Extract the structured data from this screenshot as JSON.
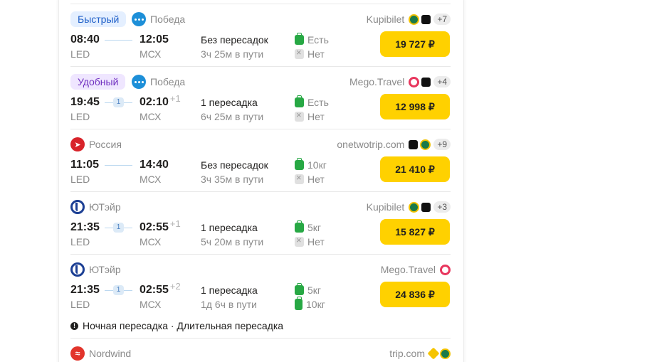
{
  "flights": [
    {
      "badge": "Быстрый",
      "badge_style": "fast",
      "logo": "pobeda",
      "airline": "Победа",
      "seller": "Kupibilet",
      "seller_icons": [
        "green",
        "black"
      ],
      "more": "+7",
      "dep_time": "08:40",
      "dep_airport": "LED",
      "arr_time": "12:05",
      "arr_plus": "",
      "arr_airport": "МСХ",
      "stops": "Без пересадок",
      "stop_count": "",
      "duration": "3ч 25м в пути",
      "baggage": [
        {
          "icon": "ok",
          "text": "Есть"
        },
        {
          "icon": "no",
          "text": "Нет"
        }
      ],
      "price": "19 727 ₽",
      "note": ""
    },
    {
      "badge": "Удобный",
      "badge_style": "comfy",
      "logo": "pobeda",
      "airline": "Победа",
      "seller": "Mego.Travel",
      "seller_icons": [
        "pink",
        "black"
      ],
      "more": "+4",
      "dep_time": "19:45",
      "dep_airport": "LED",
      "arr_time": "02:10",
      "arr_plus": "+1",
      "arr_airport": "МСХ",
      "stops": "1 пересадка",
      "stop_count": "1",
      "duration": "6ч 25м в пути",
      "baggage": [
        {
          "icon": "ok",
          "text": "Есть"
        },
        {
          "icon": "no",
          "text": "Нет"
        }
      ],
      "price": "12 998 ₽",
      "note": ""
    },
    {
      "badge": "",
      "badge_style": "",
      "logo": "rossiya",
      "airline": "Россия",
      "seller": "onetwotrip.com",
      "seller_icons": [
        "black",
        "green"
      ],
      "more": "+9",
      "dep_time": "11:05",
      "dep_airport": "LED",
      "arr_time": "14:40",
      "arr_plus": "",
      "arr_airport": "МСХ",
      "stops": "Без пересадок",
      "stop_count": "",
      "duration": "3ч 35м в пути",
      "baggage": [
        {
          "icon": "ok",
          "text": "10кг"
        },
        {
          "icon": "no",
          "text": "Нет"
        }
      ],
      "price": "21 410 ₽",
      "note": ""
    },
    {
      "badge": "",
      "badge_style": "",
      "logo": "utair",
      "airline": "ЮТэйр",
      "seller": "Kupibilet",
      "seller_icons": [
        "green",
        "black"
      ],
      "more": "+3",
      "dep_time": "21:35",
      "dep_airport": "LED",
      "arr_time": "02:55",
      "arr_plus": "+1",
      "arr_airport": "МСХ",
      "stops": "1 пересадка",
      "stop_count": "1",
      "duration": "5ч 20м в пути",
      "baggage": [
        {
          "icon": "ok",
          "text": "5кг"
        },
        {
          "icon": "no",
          "text": "Нет"
        }
      ],
      "price": "15 827 ₽",
      "note": ""
    },
    {
      "badge": "",
      "badge_style": "",
      "logo": "utair",
      "airline": "ЮТэйр",
      "seller": "Mego.Travel",
      "seller_icons": [
        "pink"
      ],
      "more": "",
      "dep_time": "21:35",
      "dep_airport": "LED",
      "arr_time": "02:55",
      "arr_plus": "+2",
      "arr_airport": "МСХ",
      "stops": "1 пересадка",
      "stop_count": "1",
      "duration": "1д 6ч в пути",
      "baggage": [
        {
          "icon": "ok",
          "text": "5кг"
        },
        {
          "icon": "ok-tall",
          "text": "10кг"
        }
      ],
      "price": "24 836 ₽",
      "note": "Ночная пересадка · Длительная пересадка"
    },
    {
      "badge": "",
      "badge_style": "",
      "logo": "nordwind",
      "airline": "Nordwind",
      "seller": "trip.com",
      "seller_icons": [
        "yellow",
        "green"
      ],
      "more": "",
      "partial": true
    }
  ]
}
